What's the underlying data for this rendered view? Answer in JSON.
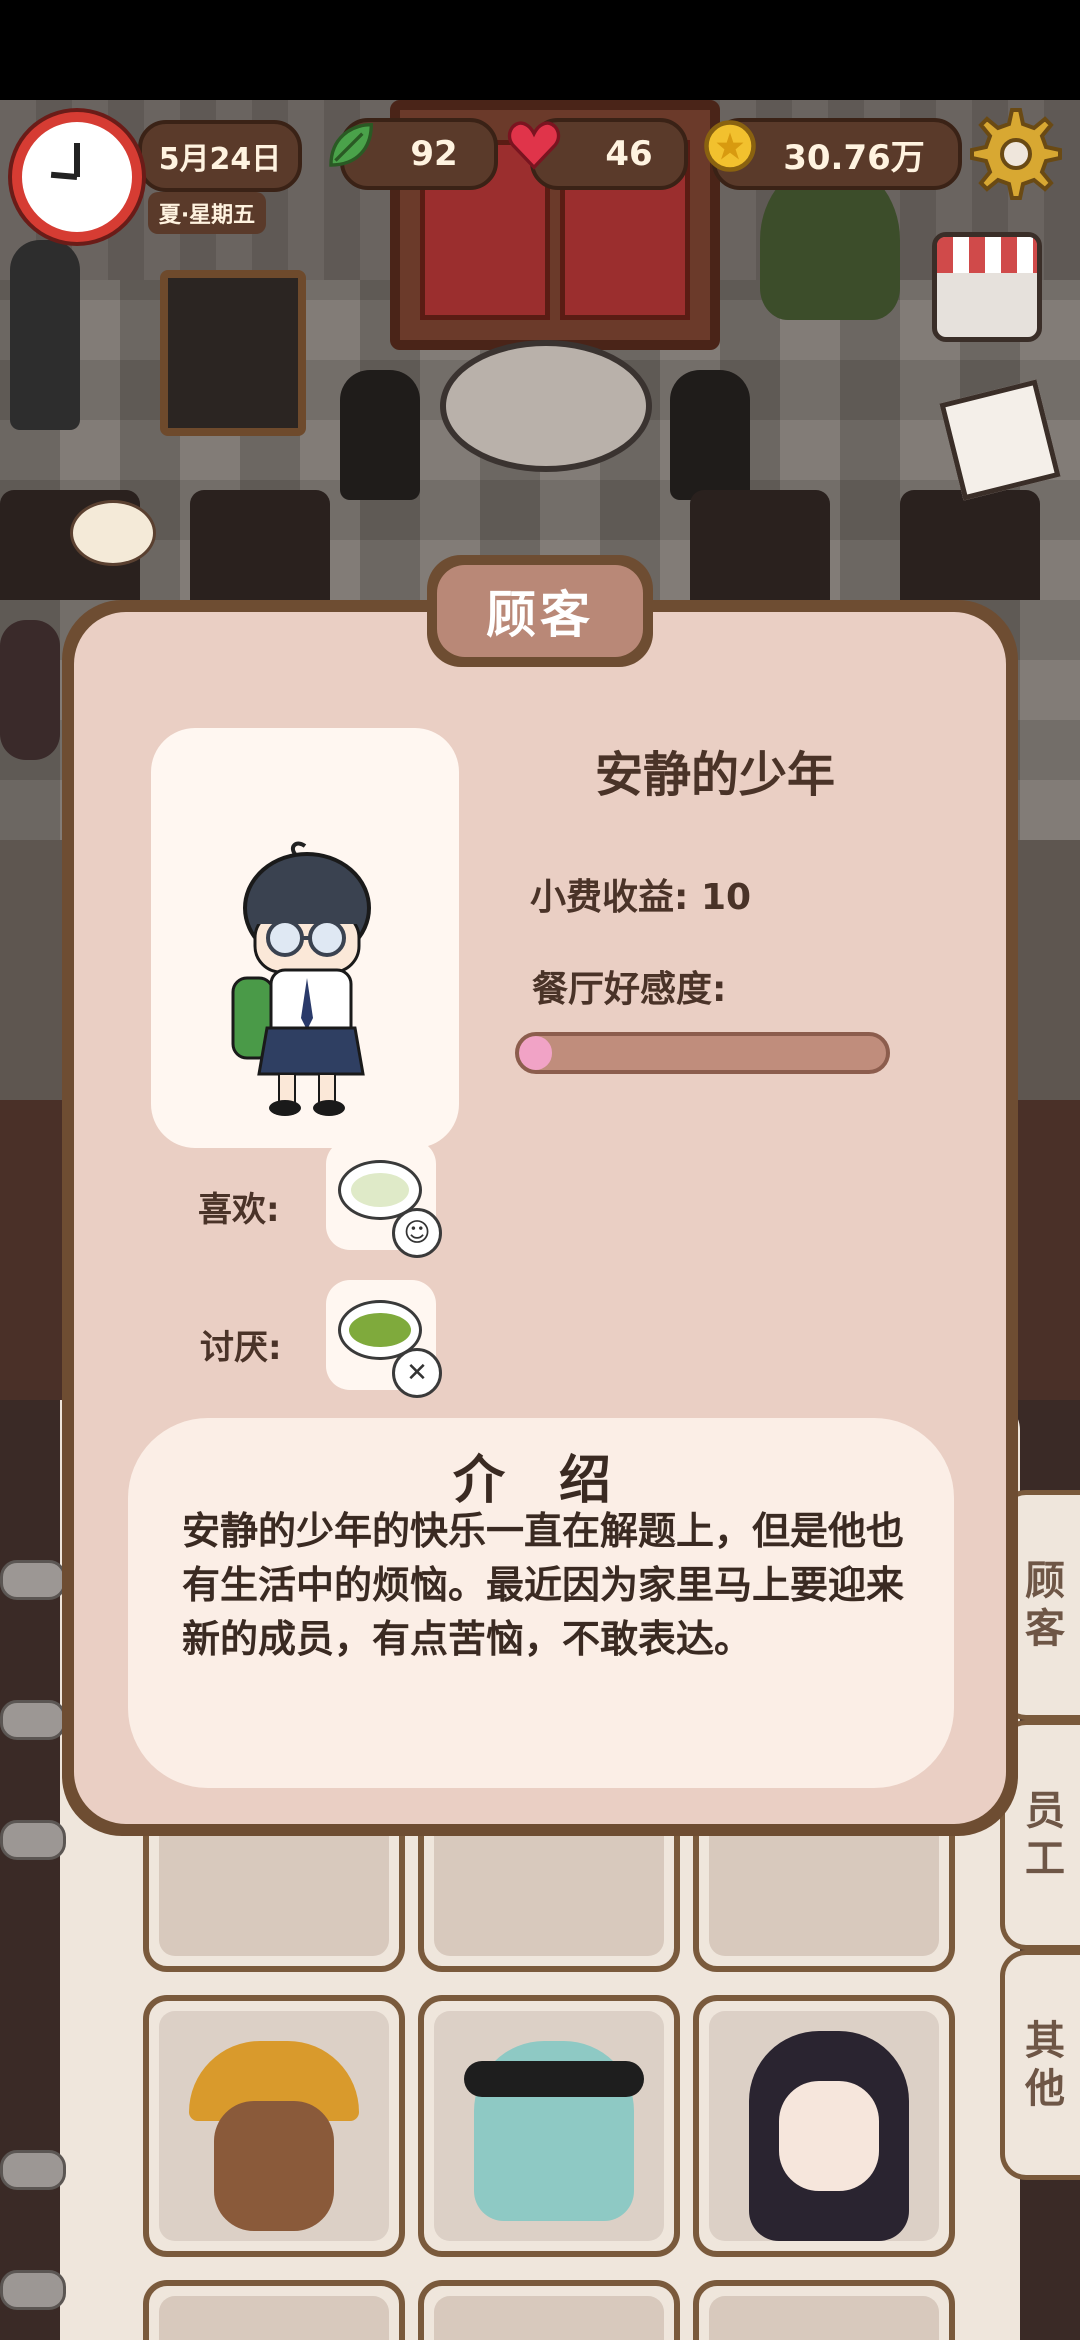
{
  "hud": {
    "date": "5月24日",
    "season_day": "夏·星期五",
    "leaves": "92",
    "hearts": "46",
    "coins": "30.76万"
  },
  "modal": {
    "title": "顾客",
    "customer_name": "安静的少年",
    "tip_label": "小费收益:",
    "tip_value": "10",
    "favor_label": "餐厅好感度:",
    "favor_fraction": 0.09,
    "likes_label": "喜欢:",
    "dislikes_label": "讨厌:",
    "intro_title": "介 绍",
    "intro_text": "安静的少年的快乐一直在解题上，但是他也有生活中的烦恼。最近因为家里马上要迎来新的成员，有点苦恼，不敢表达。"
  },
  "side_tabs": [
    {
      "label": "顾\n客"
    },
    {
      "label": "员\n工"
    },
    {
      "label": "其\n他"
    }
  ],
  "icons": {
    "clock": "clock-icon",
    "leaf": "leaf-icon",
    "heart": "heart-icon",
    "coin": "coin-icon",
    "settings": "gear-icon",
    "shop": "shop-icon",
    "photo": "photo-icon",
    "like_face": "happy-face-icon",
    "dislike_face": "annoyed-face-icon"
  },
  "colors": {
    "modal_border": "#6e4d32",
    "modal_bg": "#eacfc4",
    "favor_fill": "#f1a3c6",
    "favor_track": "#c08d7c",
    "clock_rim": "#d63c33"
  }
}
